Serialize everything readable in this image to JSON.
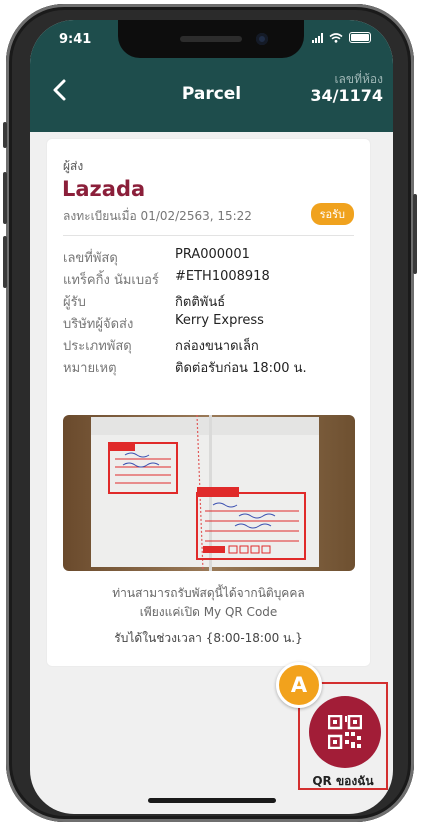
{
  "status_bar": {
    "time": "9:41"
  },
  "header": {
    "title": "Parcel",
    "room_label": "เลขที่ห้อง",
    "room_number": "34/1174"
  },
  "card": {
    "sender_label": "ผู้ส่ง",
    "sender": "Lazada",
    "registered": "ลงทะเบียนเมื่อ 01/02/2563, 15:22",
    "status_badge": "รอรับ",
    "status_color": "#f0a21e",
    "details": [
      {
        "key": "เลขที่พัสดุ",
        "value": "PRA000001"
      },
      {
        "key": "แทร็คกิ้ง นัมเบอร์",
        "value": "#ETH1008918"
      },
      {
        "key": "ผู้รับ",
        "value": "กิตติพันธ์"
      },
      {
        "key": "บริษัทผู้จัดส่ง",
        "value": "Kerry Express"
      },
      {
        "key": "ประเภทพัสดุ",
        "value": "กล่องขนาดเล็ก"
      },
      {
        "key": "หมายเหตุ",
        "value": "ติดต่อรับก่อน 18:00 น."
      }
    ],
    "note_line1": "ท่านสามารถรับพัสดุนี้ได้จากนิติบุคคล",
    "note_line2": "เพียงแค่เปิด My QR Code",
    "pickup_time": "รับได้ในช่วงเวลา {8:00-18:00 น.}"
  },
  "qr_button": {
    "label": "QR ของฉัน",
    "icon": "qr-code-icon"
  },
  "annotation": {
    "marker": "A"
  },
  "colors": {
    "header_bg": "#1e4d4c",
    "brand": "#8b1f3a",
    "fab": "#a21d37",
    "highlight": "#d32f2f"
  }
}
